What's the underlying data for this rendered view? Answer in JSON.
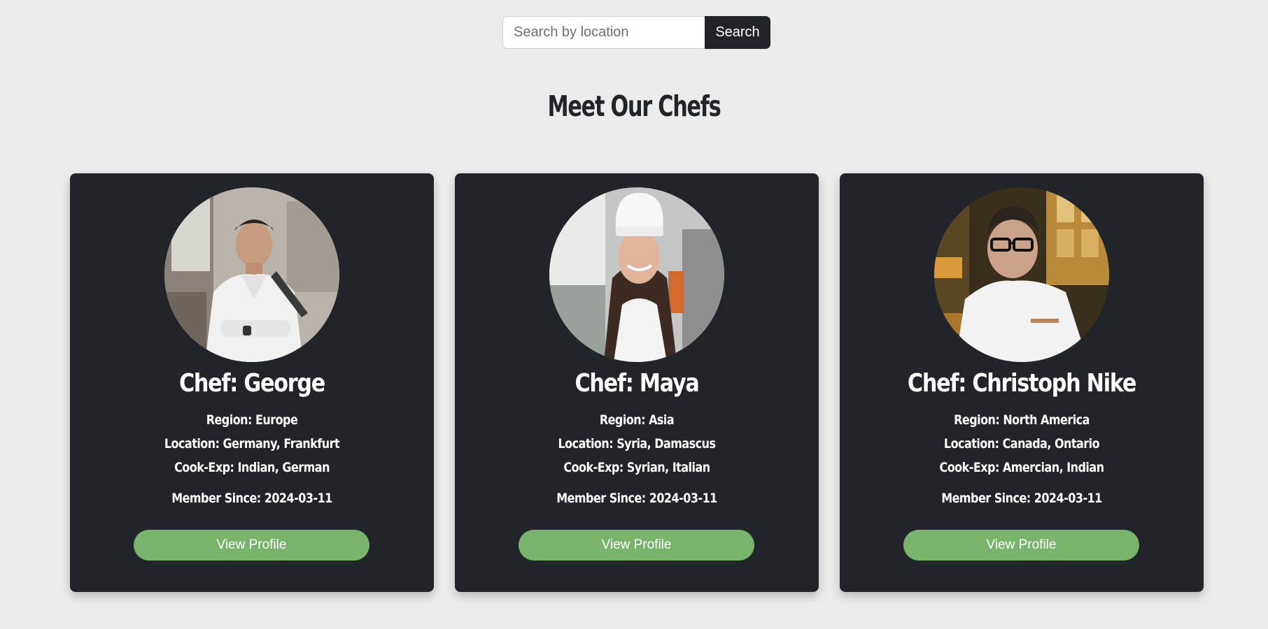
{
  "search": {
    "placeholder": "Search by location",
    "button_label": "Search"
  },
  "page_title": "Meet Our Chefs",
  "chefs": [
    {
      "name": "Chef: George",
      "region_label": "Region:",
      "region": "Europe",
      "location_label": "Location:",
      "location": "Germany, Frankfurt",
      "cookexp_label": "Cook-Exp:",
      "cookexp": "Indian, German",
      "member_label": "Member Since:",
      "member_since": "2024-03-11",
      "button_label": "View Profile"
    },
    {
      "name": "Chef: Maya",
      "region_label": "Region:",
      "region": "Asia",
      "location_label": "Location:",
      "location": "Syria, Damascus",
      "cookexp_label": "Cook-Exp:",
      "cookexp": "Syrian, Italian",
      "member_label": "Member Since:",
      "member_since": "2024-03-11",
      "button_label": "View Profile"
    },
    {
      "name": "Chef: Christoph Nike",
      "region_label": "Region:",
      "region": "North America",
      "location_label": "Location:",
      "location": "Canada, Ontario",
      "cookexp_label": "Cook-Exp:",
      "cookexp": "Amercian, Indian",
      "member_label": "Member Since:",
      "member_since": "2024-03-11",
      "button_label": "View Profile"
    }
  ],
  "colors": {
    "page_bg": "#ececec",
    "card_bg": "#212529",
    "button_green": "#78b46c",
    "search_button": "#212529"
  }
}
